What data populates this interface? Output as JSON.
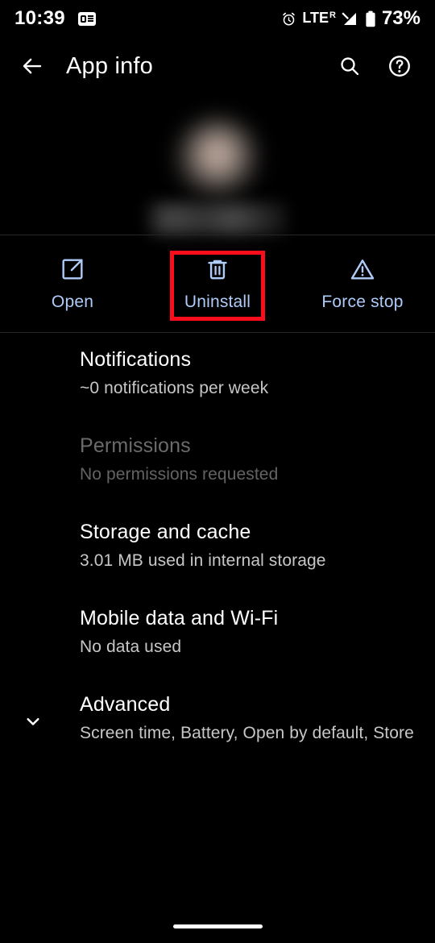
{
  "status_bar": {
    "time": "10:39",
    "notification_icon": "google-news-notification-icon",
    "alarm_icon": "alarm-clock-icon",
    "network_type": "LTE",
    "roaming_indicator": "R",
    "signal_icon": "signal-bars-icon",
    "battery_icon": "battery-icon",
    "battery_percent": "73%"
  },
  "app_bar": {
    "back_icon": "back-arrow-icon",
    "title": "App info",
    "search_icon": "search-icon",
    "help_icon": "help-circle-icon"
  },
  "app_header": {
    "app_icon": "blurred-app-icon",
    "app_name": "",
    "app_name_redacted": true
  },
  "actions": [
    {
      "label": "Open",
      "icon": "open-in-new-icon",
      "highlighted": false
    },
    {
      "label": "Uninstall",
      "icon": "trash-can-icon",
      "highlighted": true
    },
    {
      "label": "Force stop",
      "icon": "warning-triangle-icon",
      "highlighted": false
    }
  ],
  "highlight": {
    "target": "Uninstall",
    "color": "#fb0d1b"
  },
  "settings_rows": [
    {
      "title": "Notifications",
      "subtitle": "~0 notifications per week",
      "disabled": false,
      "chevron": ""
    },
    {
      "title": "Permissions",
      "subtitle": "No permissions requested",
      "disabled": true,
      "chevron": ""
    },
    {
      "title": "Storage and cache",
      "subtitle": "3.01 MB used in internal storage",
      "disabled": false,
      "chevron": ""
    },
    {
      "title": "Mobile data and Wi-Fi",
      "subtitle": "No data used",
      "disabled": false,
      "chevron": ""
    },
    {
      "title": "Advanced",
      "subtitle": "Screen time, Battery, Open by default, Store",
      "disabled": false,
      "chevron": "chevron-down-icon"
    }
  ],
  "nav_bar": {
    "gesture_pill": "home-gesture-pill"
  },
  "colors": {
    "background": "#000000",
    "primary_text": "#ffffff",
    "secondary_text": "#c7c7c7",
    "disabled_text": "#6b6b6b",
    "accent_blue": "#aecbfa",
    "highlight_red": "#fb0d1b",
    "divider": "#252525"
  }
}
